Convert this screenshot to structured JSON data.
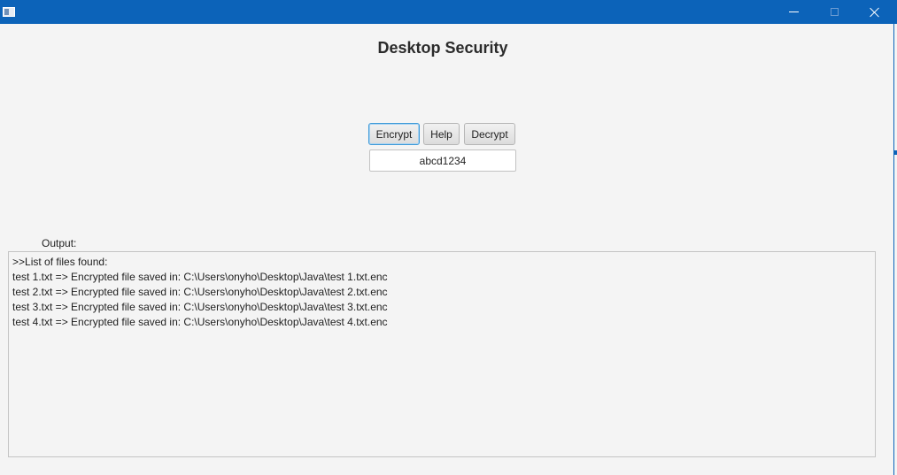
{
  "window": {
    "title_bar_color": "#0c63b9",
    "icons": {
      "app": "app-window-icon",
      "minimize": "minimize-icon",
      "maximize": "maximize-icon",
      "close": "close-icon"
    }
  },
  "heading": "Desktop Security",
  "toolbar": {
    "encrypt_label": "Encrypt",
    "help_label": "Help",
    "decrypt_label": "Decrypt"
  },
  "key_input": {
    "value": "abcd1234"
  },
  "output": {
    "label": "Output:",
    "lines": [
      ">>List of files found:",
      "test 1.txt => Encrypted file saved in: C:\\Users\\onyho\\Desktop\\Java\\test 1.txt.enc",
      "test 2.txt => Encrypted file saved in: C:\\Users\\onyho\\Desktop\\Java\\test 2.txt.enc",
      "test 3.txt => Encrypted file saved in: C:\\Users\\onyho\\Desktop\\Java\\test 3.txt.enc",
      "test 4.txt => Encrypted file saved in: C:\\Users\\onyho\\Desktop\\Java\\test 4.txt.enc"
    ]
  }
}
